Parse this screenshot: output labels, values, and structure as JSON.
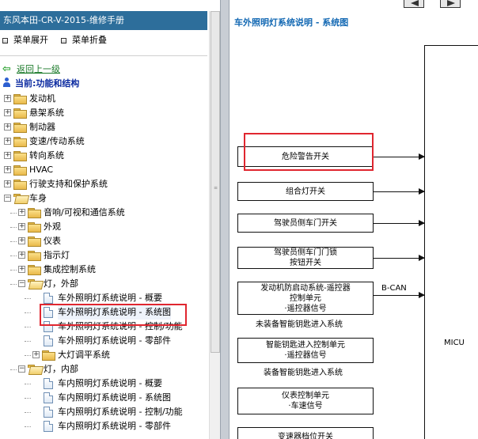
{
  "left": {
    "title": "东风本田-CR-V-2015-维修手册",
    "expand_label": "菜单展开",
    "collapse_label": "菜单折叠",
    "back_label": "返回上一级",
    "current_label": "当前:功能和结构"
  },
  "tree": [
    {
      "label": "发动机",
      "state": "+",
      "type": "folder",
      "level": 0
    },
    {
      "label": "悬架系统",
      "state": "+",
      "type": "folder",
      "level": 0
    },
    {
      "label": "制动器",
      "state": "+",
      "type": "folder",
      "level": 0
    },
    {
      "label": "变速/传动系统",
      "state": "+",
      "type": "folder",
      "level": 0
    },
    {
      "label": "转向系统",
      "state": "+",
      "type": "folder",
      "level": 0
    },
    {
      "label": "HVAC",
      "state": "+",
      "type": "folder",
      "level": 0
    },
    {
      "label": "行驶支持和保护系统",
      "state": "+",
      "type": "folder",
      "level": 0
    },
    {
      "label": "车身",
      "state": "-",
      "type": "folder",
      "level": 0
    },
    {
      "label": "音响/可视和通信系统",
      "state": "+",
      "type": "folder",
      "level": 1
    },
    {
      "label": "外观",
      "state": "+",
      "type": "folder",
      "level": 1
    },
    {
      "label": "仪表",
      "state": "+",
      "type": "folder",
      "level": 1
    },
    {
      "label": "指示灯",
      "state": "+",
      "type": "folder",
      "level": 1
    },
    {
      "label": "集成控制系统",
      "state": "+",
      "type": "folder",
      "level": 1
    },
    {
      "label": "灯，外部",
      "state": "-",
      "type": "folder",
      "level": 1
    },
    {
      "label": "车外照明灯系统说明 - 概要",
      "state": "",
      "type": "doc",
      "level": 2
    },
    {
      "label": "车外照明灯系统说明 - 系统图",
      "state": "",
      "type": "doc",
      "level": 2
    },
    {
      "label": "车外照明灯系统说明 - 控制/功能",
      "state": "",
      "type": "doc",
      "level": 2
    },
    {
      "label": "车外照明灯系统说明 - 零部件",
      "state": "",
      "type": "doc",
      "level": 2
    },
    {
      "label": "大灯调平系统",
      "state": "+",
      "type": "folder",
      "level": 2
    },
    {
      "label": "灯，内部",
      "state": "-",
      "type": "folder",
      "level": 1
    },
    {
      "label": "车内照明灯系统说明 - 概要",
      "state": "",
      "type": "doc",
      "level": 2
    },
    {
      "label": "车内照明灯系统说明 - 系统图",
      "state": "",
      "type": "doc",
      "level": 2
    },
    {
      "label": "车内照明灯系统说明 - 控制/功能",
      "state": "",
      "type": "doc",
      "level": 2
    },
    {
      "label": "车内照明灯系统说明 - 零部件",
      "state": "",
      "type": "doc",
      "level": 2
    }
  ],
  "right": {
    "heading": "车外照明灯系统说明 - 系统图",
    "boxes": [
      {
        "lines": [
          "危险警告开关"
        ]
      },
      {
        "lines": [
          "组合灯开关"
        ]
      },
      {
        "lines": [
          "驾驶员侧车门开关"
        ]
      },
      {
        "lines": [
          "驾驶员侧车门门锁",
          "按钮开关"
        ]
      },
      {
        "lines": [
          "发动机防启动系统-遥控器",
          "控制单元",
          "·遥控器信号"
        ]
      },
      {
        "lines": [
          "智能钥匙进入控制单元",
          "·遥控器信号"
        ]
      },
      {
        "lines": [
          "仪表控制单元",
          "·车速信号"
        ]
      },
      {
        "lines": [
          "变速器档位开关"
        ]
      }
    ],
    "caption_no_smart_key": "未装备智能钥匙进入系统",
    "caption_smart_key": "装备智能钥匙进入系统",
    "bcan_label": "B-CAN",
    "micu_label": "MICU"
  },
  "colors": {
    "title_bar": "#2d6e9b",
    "heading": "#1268b3",
    "highlight": "#e0262f",
    "back_link": "#1b7a2a",
    "current": "#0b2aa0"
  }
}
